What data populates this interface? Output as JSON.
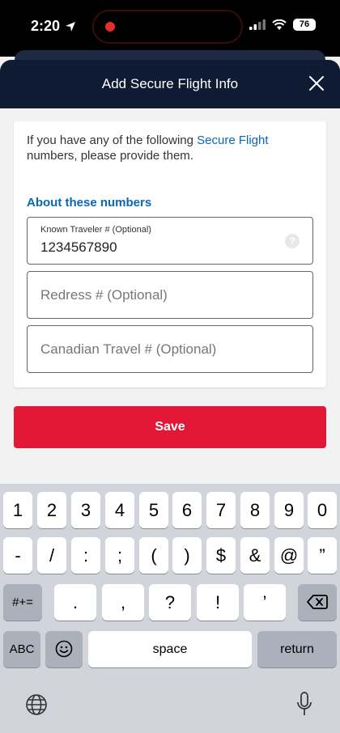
{
  "status_bar": {
    "time": "2:20",
    "battery": "76"
  },
  "modal": {
    "title": "Add Secure Flight Info"
  },
  "card": {
    "intro_prefix": "If you have any of the following ",
    "intro_link": "Secure Flight",
    "intro_suffix": " numbers, please provide them.",
    "about_link": "About these numbers",
    "fields": [
      {
        "label": "Known Traveler # (Optional)",
        "value": "1234567890"
      },
      {
        "placeholder": "Redress # (Optional)"
      },
      {
        "placeholder": "Canadian Travel # (Optional)"
      }
    ]
  },
  "save_label": "Save",
  "keyboard": {
    "row1": [
      "1",
      "2",
      "3",
      "4",
      "5",
      "6",
      "7",
      "8",
      "9",
      "0"
    ],
    "row2": [
      "-",
      "/",
      ":",
      ";",
      "(",
      ")",
      "$",
      "&",
      "@",
      "”"
    ],
    "row3_left": "#+=",
    "row3": [
      ".",
      ",",
      "?",
      "!",
      "’"
    ],
    "row4_abc": "ABC",
    "space": "space",
    "return": "return"
  }
}
